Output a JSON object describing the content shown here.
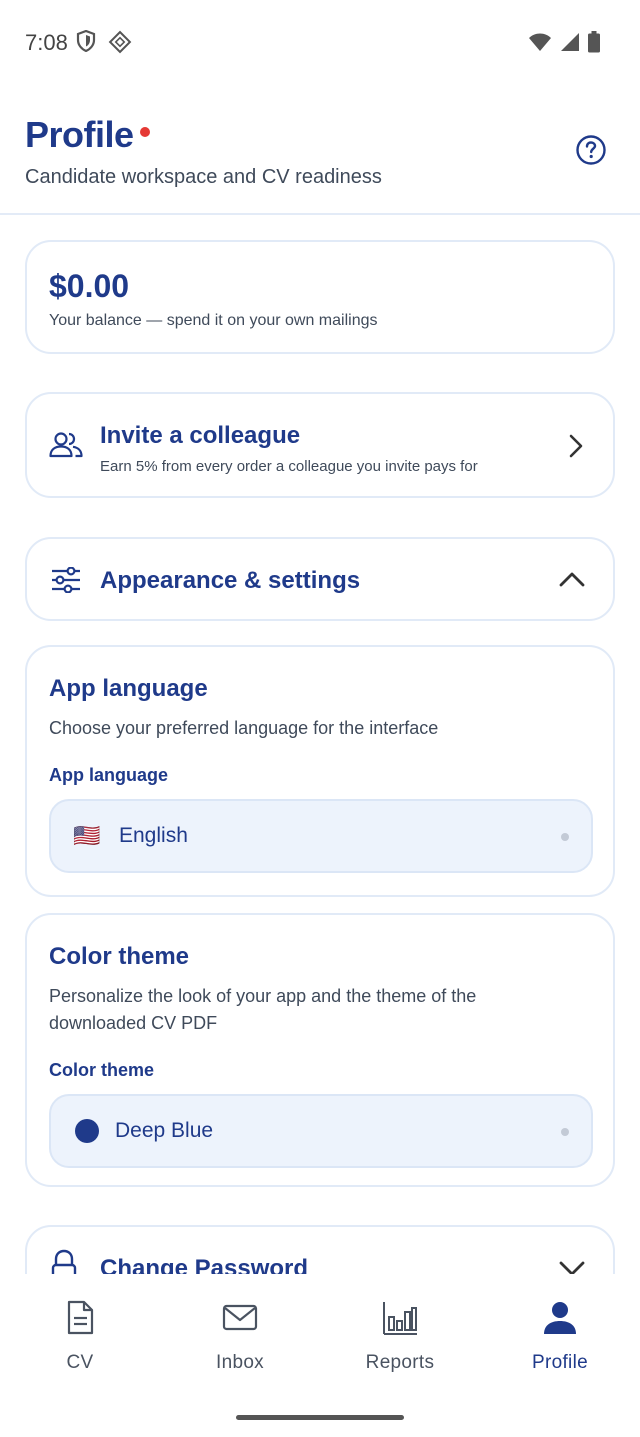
{
  "status_bar": {
    "time": "7:08"
  },
  "header": {
    "title": "Profile",
    "subtitle": "Candidate workspace and CV readiness"
  },
  "balance": {
    "amount": "$0.00",
    "caption": "Your balance — spend it on your own mailings"
  },
  "invite": {
    "title": "Invite a colleague",
    "caption": "Earn 5% from every order a colleague you invite pays for"
  },
  "appearance": {
    "title": "Appearance & settings",
    "expanded": true
  },
  "language": {
    "title": "App language",
    "description": "Choose your preferred language for the interface",
    "field_label": "App language",
    "selected_flag": "🇺🇸",
    "selected_value": "English"
  },
  "theme": {
    "title": "Color theme",
    "description": "Personalize the look of your app and the theme of the downloaded CV PDF",
    "field_label": "Color theme",
    "selected_value": "Deep Blue",
    "selected_color": "#1f3a8a"
  },
  "password": {
    "title": "Change Password"
  },
  "nav": {
    "items": [
      {
        "label": "CV",
        "icon": "document-icon",
        "active": false
      },
      {
        "label": "Inbox",
        "icon": "mail-icon",
        "active": false
      },
      {
        "label": "Reports",
        "icon": "bar-chart-icon",
        "active": false
      },
      {
        "label": "Profile",
        "icon": "person-icon",
        "active": true
      }
    ]
  },
  "colors": {
    "accent": "#1f3a8a",
    "notification_dot": "#e53935",
    "card_border": "#e1eaf7",
    "select_background": "#edf3fc"
  }
}
